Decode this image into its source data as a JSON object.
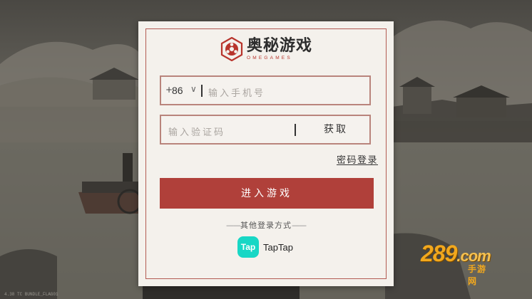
{
  "logo": {
    "name_cn": "奥秘游戏",
    "name_en": "OMEGAMES",
    "brand_color": "#b8342c"
  },
  "phone_field": {
    "plus": "+",
    "country_code": "86",
    "chevron_icon": "chevron-down-icon",
    "placeholder": "输入手机号"
  },
  "code_field": {
    "placeholder": "输入验证码",
    "get_code_label": "获取"
  },
  "password_login_label": "密码登录",
  "enter_button_label": "进入游戏",
  "other_login": {
    "label": "其他登录方式",
    "taptap_icon_text": "Tap",
    "taptap_label": "TapTap"
  },
  "watermark": {
    "main": "289",
    "domain": ".com",
    "sub": "手游网"
  },
  "build_text": "4.38  TC  BUNDLE_FLAG01",
  "colors": {
    "button": "#b0403a",
    "field_border": "#b9847c",
    "card_bg": "#f4f1ec",
    "taptap": "#18d7c5"
  }
}
